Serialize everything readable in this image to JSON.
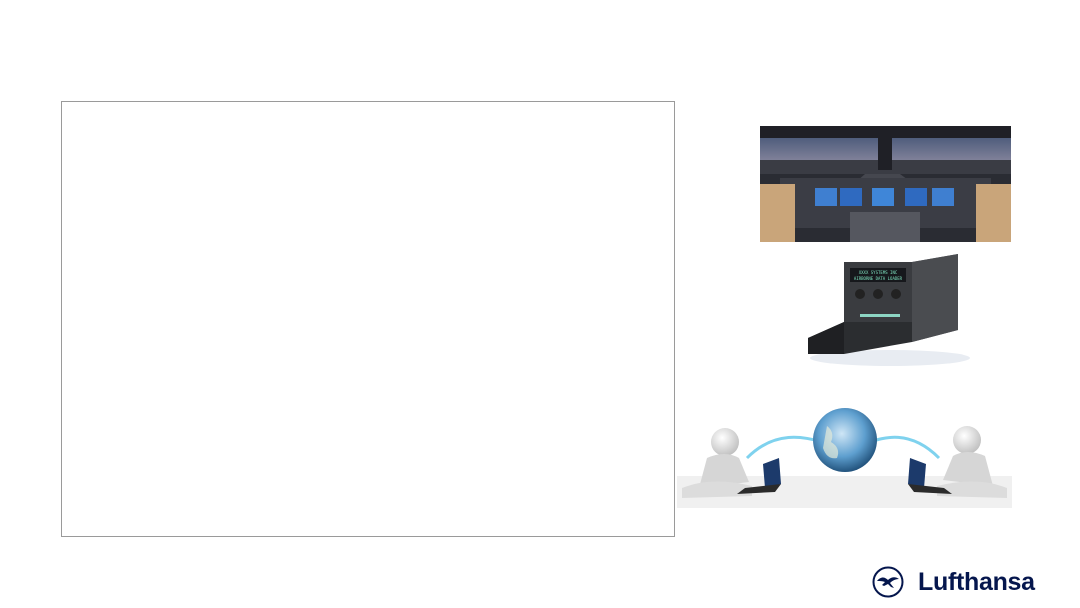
{
  "slide": {
    "image_cockpit": "airliner-cockpit-photo",
    "image_recorder": "airborne-data-loader-unit-photo",
    "image_network": "two-figures-connected-via-globe-illustration",
    "recorder_panel_line1": "XXXX SYSTEMS INC",
    "recorder_panel_line2": "AIRBORNE DATA LOADER"
  },
  "brand": {
    "name": "Lufthansa",
    "icon": "crane-logo-icon",
    "color": "#05164d"
  }
}
